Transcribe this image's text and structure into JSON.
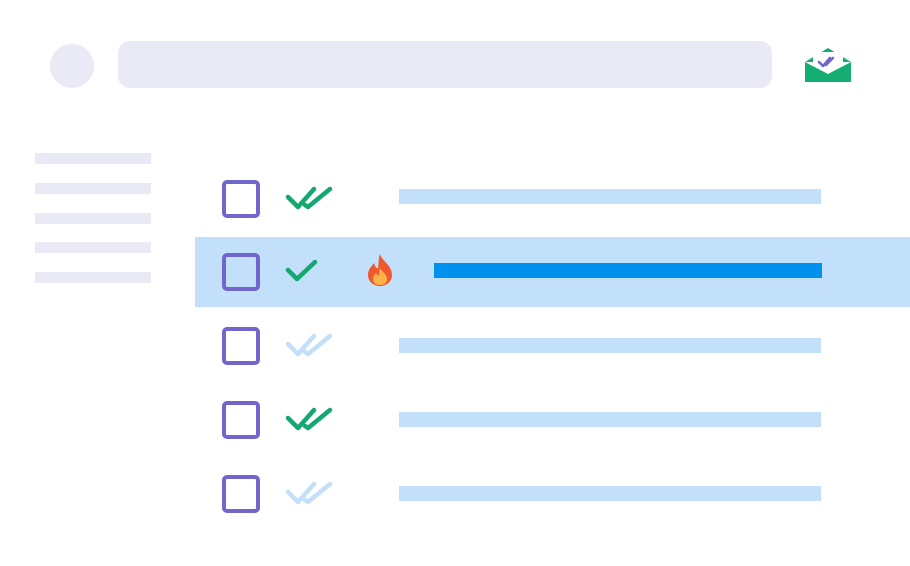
{
  "colors": {
    "placeholder": "#eaeaf6",
    "checkbox_border": "#7166cc",
    "read_green": "#13a870",
    "unread_blue": "#c3e0fb",
    "row_highlight": "#c3e0fb",
    "bar_light": "#c3e0fb",
    "bar_strong": "#0091ee",
    "flame_outer": "#ef5a2c",
    "flame_inner": "#ffb14a",
    "mail_green": "#14ae73",
    "mail_check": "#7166cc"
  },
  "header": {
    "avatar_icon": "avatar-placeholder",
    "search_placeholder": "",
    "mail_icon": "open-envelope-double-check-icon"
  },
  "sidebar": {
    "items": [
      {
        "label": ""
      },
      {
        "label": ""
      },
      {
        "label": ""
      },
      {
        "label": ""
      },
      {
        "label": ""
      }
    ]
  },
  "messages": [
    {
      "checked": false,
      "status": "read-double-check",
      "hot": false,
      "selected": false,
      "subject": ""
    },
    {
      "checked": false,
      "status": "single-check",
      "hot": true,
      "selected": true,
      "subject": ""
    },
    {
      "checked": false,
      "status": "unread-double-check",
      "hot": false,
      "selected": false,
      "subject": ""
    },
    {
      "checked": false,
      "status": "read-double-check",
      "hot": false,
      "selected": false,
      "subject": ""
    },
    {
      "checked": false,
      "status": "unread-double-check",
      "hot": false,
      "selected": false,
      "subject": ""
    }
  ]
}
